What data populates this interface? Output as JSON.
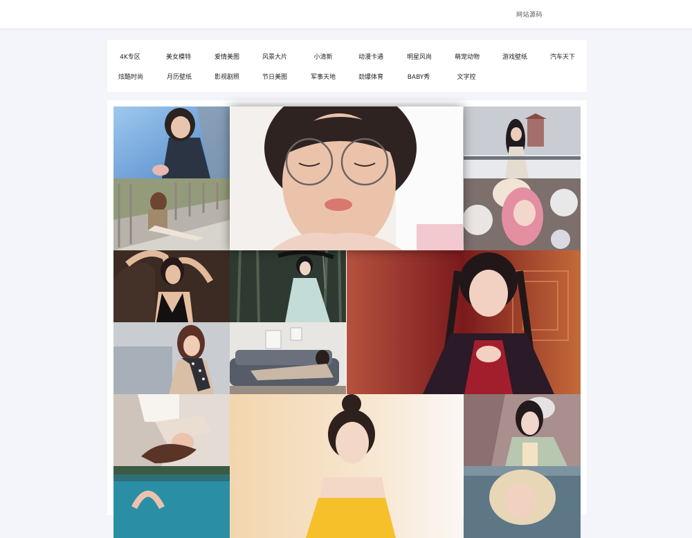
{
  "header": {
    "source_link": "网站源码"
  },
  "categories": {
    "row1": [
      "4K专区",
      "美女模特",
      "爱情美图",
      "风景大片",
      "小清新",
      "动漫卡通",
      "明星风尚",
      "萌宠动物",
      "游戏壁纸",
      "汽车天下"
    ],
    "row2": [
      "炫酷时尚",
      "月历壁纸",
      "影视剧照",
      "节日美图",
      "军事天地",
      "劲爆体育",
      "BABY秀",
      "文字控"
    ]
  },
  "gallery": {
    "photos": [
      "girl-smiling-blue-sky-fence",
      "girl-eyes-closed-glasses-pouting",
      "girl-snow-pavilion",
      "girl-sitting-railing-bridge",
      "girl-pink-hair-winter-flowers",
      "woman-black-dress-hands-on-head",
      "girl-white-hanfu-umbrella-forest",
      "girl-red-hanfu-chinese-window",
      "woman-scarf-beige-coat",
      "girl-lying-grey-sofa",
      "woman-lying-bed-white-sheets",
      "girl-hair-bun-yellow-dress",
      "girl-green-hanfu-hair-ornament",
      "woman-by-pool",
      "blonde-woman-windblown-hair"
    ]
  }
}
